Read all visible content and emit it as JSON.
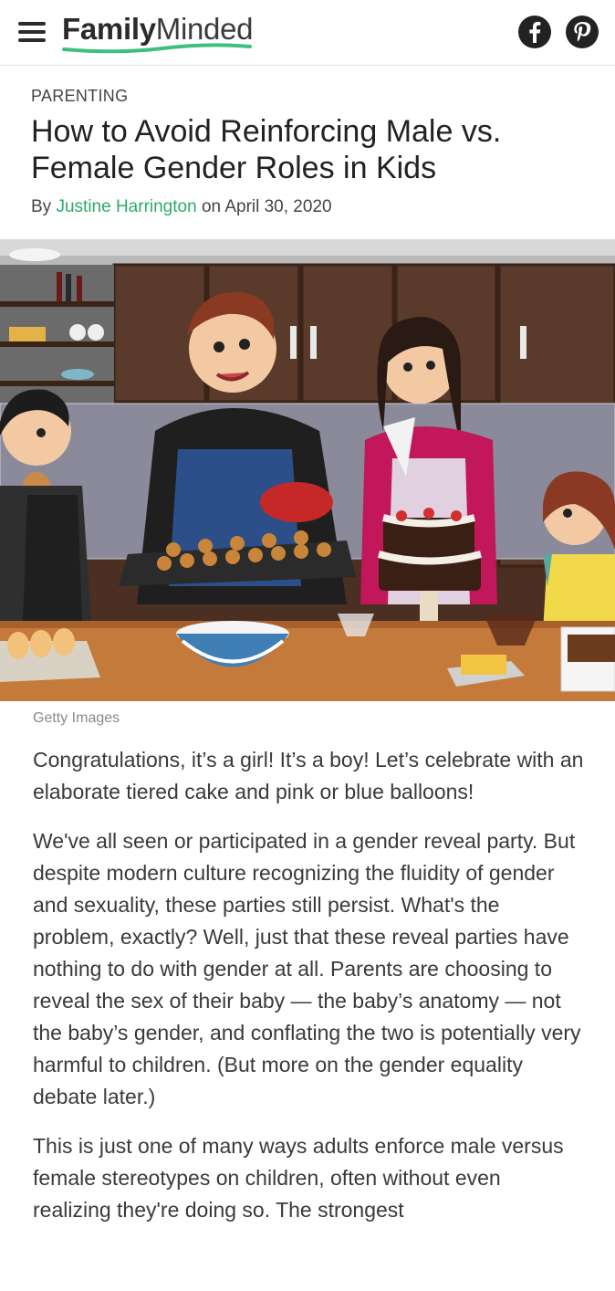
{
  "header": {
    "logo_part1": "Family",
    "logo_part2": "Minded",
    "menu_icon": "hamburger-menu-icon",
    "social": [
      {
        "icon": "facebook-icon"
      },
      {
        "icon": "pinterest-icon"
      }
    ],
    "brand_color": "#2eaa6a"
  },
  "article": {
    "category": "PARENTING",
    "title": "How to Avoid Reinforcing Male vs. Female Gender Roles in Kids",
    "byline_prefix": "By",
    "author": "Justine Harrington",
    "byline_on": "on",
    "date": "April 30, 2020",
    "image_credit": "Getty Images",
    "paragraphs": [
      "Congratulations, it’s a girl! It’s a boy! Let’s celebrate with an elaborate tiered cake and pink or blue balloons!",
      "We've all seen or participated in a gender reveal party. But despite modern culture recognizing the fluidity of gender and sexuality, these parties still persist. What's the problem, exactly? Well, just that these reveal parties have nothing to do with gender at all. Parents are choosing to reveal the sex of their baby — the baby’s anatomy — not the baby’s gender, and conflating the two is potentially very harmful to children. (But more on the gender equality debate later.)",
      "This is just one of many ways adults enforce male versus female stereotypes on children, often without even realizing they're doing so. The strongest"
    ]
  }
}
